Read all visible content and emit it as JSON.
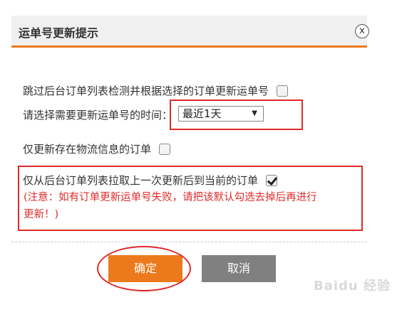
{
  "dialog": {
    "title": "运单号更新提示",
    "close_label": "x"
  },
  "options": {
    "skip_label": "跳过后台订单列表检测并根据选择的订单更新运单号",
    "skip_checked": false,
    "time_label": "请选择需要更新运单号的时间：",
    "time_select_value": "最近1天",
    "logistics_label": "仅更新存在物流信息的订单",
    "logistics_checked": false,
    "pull_label": "仅从后台订单列表拉取上一次更新后到当前的订单",
    "pull_checked": true
  },
  "note": {
    "line1": "(注意：如有订单更新运单号失败，请把该默认勾选去掉后再进行",
    "line2": "更新！)"
  },
  "buttons": {
    "ok_label": "确定",
    "cancel_label": "取消"
  },
  "watermark": "Baidu 经验",
  "colors": {
    "accent": "#ec7a1c",
    "highlight_red": "#e02a2a",
    "cancel_gray": "#808080"
  }
}
